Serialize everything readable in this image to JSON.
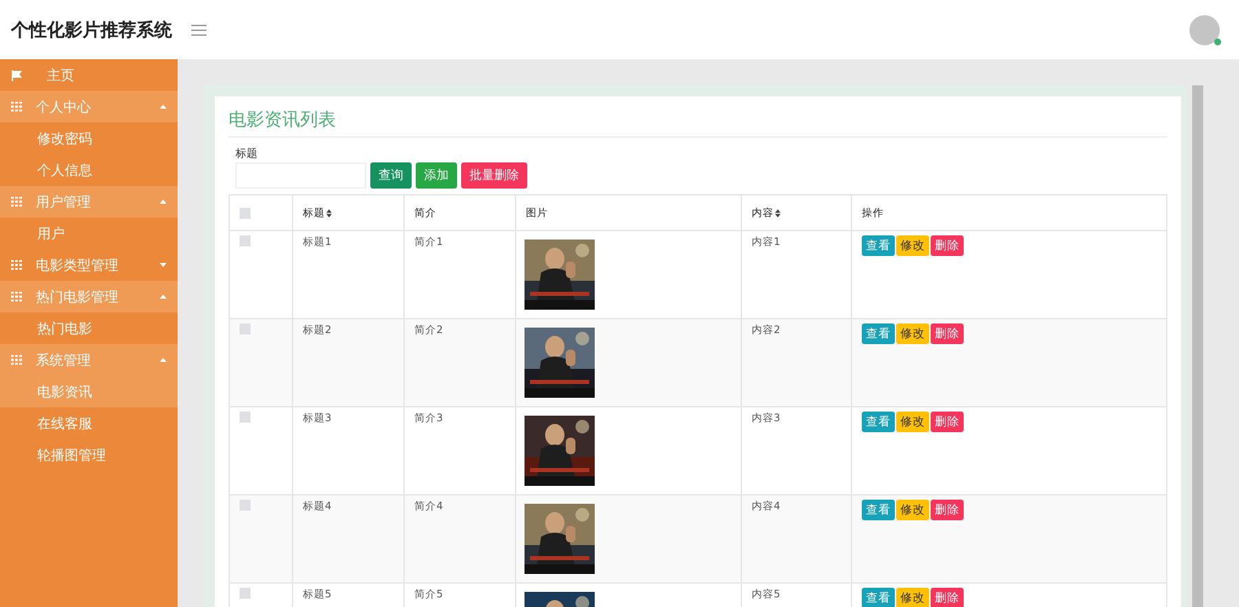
{
  "header": {
    "title": "个性化影片推荐系统",
    "user": {
      "online": true
    }
  },
  "sidebar": {
    "items": [
      {
        "kind": "link",
        "label": "主页",
        "selected": false
      },
      {
        "kind": "group",
        "label": "个人中心",
        "expanded": true,
        "children": [
          {
            "label": "修改密码",
            "selected": false
          },
          {
            "label": "个人信息",
            "selected": false
          }
        ]
      },
      {
        "kind": "group",
        "label": "用户管理",
        "expanded": true,
        "children": [
          {
            "label": "用户",
            "selected": false
          }
        ]
      },
      {
        "kind": "group",
        "label": "电影类型管理",
        "expanded": false
      },
      {
        "kind": "group",
        "label": "热门电影管理",
        "expanded": true,
        "children": [
          {
            "label": "热门电影",
            "selected": false
          }
        ]
      },
      {
        "kind": "group",
        "label": "系统管理",
        "expanded": true,
        "children": [
          {
            "label": "电影资讯",
            "selected": true
          },
          {
            "label": "在线客服",
            "selected": false
          },
          {
            "label": "轮播图管理",
            "selected": false
          }
        ]
      }
    ]
  },
  "card": {
    "title": "电影资讯列表",
    "search": {
      "label": "标题"
    },
    "buttons": [
      {
        "kind": "query",
        "label": "查询"
      },
      {
        "kind": "add",
        "label": "添加"
      },
      {
        "kind": "delete",
        "label": "批量删除"
      }
    ],
    "table": {
      "select_all": {
        "checked": false
      },
      "columns": [
        {
          "label": "标题",
          "sortable": true
        },
        {
          "label": "简介",
          "sortable": false
        },
        {
          "label": "图片",
          "sortable": false
        },
        {
          "label": "内容",
          "sortable": true
        },
        {
          "label": "操作",
          "sortable": false
        }
      ],
      "rows": [
        {
          "checked": false,
          "title": "标题1",
          "summary": "简介1",
          "content": "内容1",
          "actions": [
            {
              "kind": "view",
              "label": "查看"
            },
            {
              "kind": "edit",
              "label": "修改"
            },
            {
              "kind": "delete",
              "label": "删除"
            }
          ]
        },
        {
          "checked": false,
          "title": "标题2",
          "summary": "简介2",
          "content": "内容2",
          "actions": [
            {
              "kind": "view",
              "label": "查看"
            },
            {
              "kind": "edit",
              "label": "修改"
            },
            {
              "kind": "delete",
              "label": "删除"
            }
          ]
        },
        {
          "checked": false,
          "title": "标题3",
          "summary": "简介3",
          "content": "内容3",
          "actions": [
            {
              "kind": "view",
              "label": "查看"
            },
            {
              "kind": "edit",
              "label": "修改"
            },
            {
              "kind": "delete",
              "label": "删除"
            }
          ]
        },
        {
          "checked": false,
          "title": "标题4",
          "summary": "简介4",
          "content": "内容4",
          "actions": [
            {
              "kind": "view",
              "label": "查看"
            },
            {
              "kind": "edit",
              "label": "修改"
            },
            {
              "kind": "delete",
              "label": "删除"
            }
          ]
        },
        {
          "checked": false,
          "title": "标题5",
          "summary": "简介5",
          "content": "内容5",
          "actions": [
            {
              "kind": "view",
              "label": "查看"
            },
            {
              "kind": "edit",
              "label": "修改"
            },
            {
              "kind": "delete",
              "label": "删除"
            }
          ]
        }
      ]
    }
  }
}
